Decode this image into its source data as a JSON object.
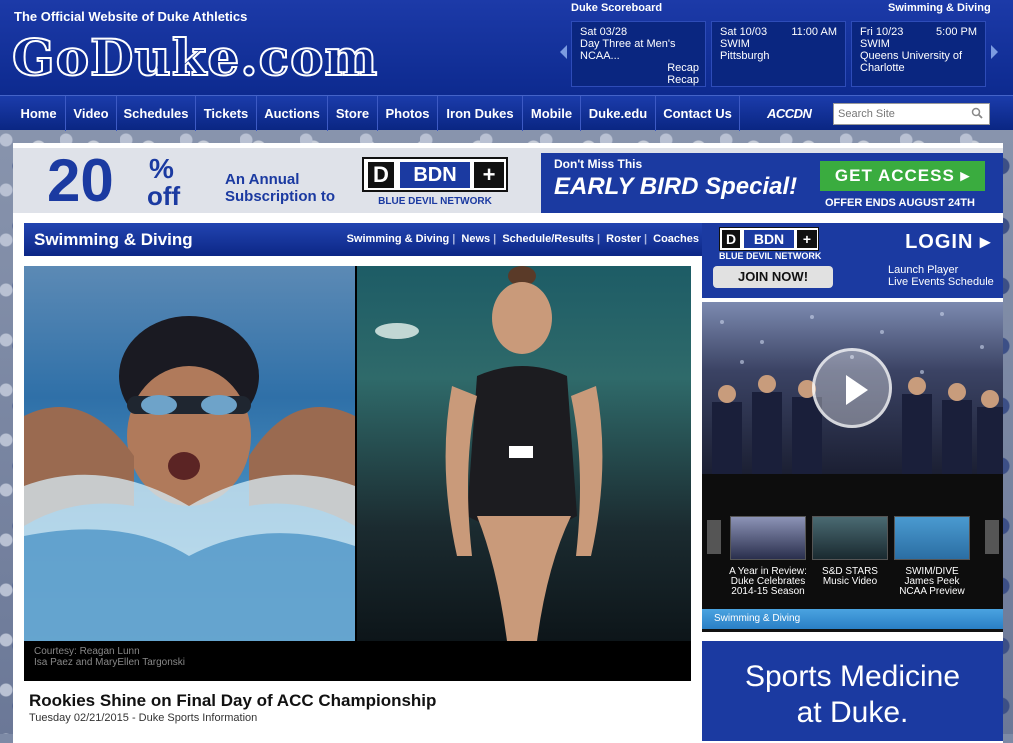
{
  "header": {
    "tagline": "The Official Website of Duke Athletics",
    "logo": "GoDuke.com"
  },
  "scoreboard": {
    "label": "Duke Scoreboard",
    "sport_label": "Swimming & Diving",
    "games": [
      {
        "date": "Sat 03/28",
        "line1": "Day Three at Men's",
        "line2": "NCAA...",
        "time": "",
        "rec1": "Recap",
        "rec2": "Recap"
      },
      {
        "date": "Sat  10/03",
        "line1": "SWIM",
        "line2": "Pittsburgh",
        "time": "11:00 AM",
        "rec1": "",
        "rec2": ""
      },
      {
        "date": "Fri  10/23",
        "line1": "SWIM",
        "line2": "Queens University of Charlotte",
        "time": "5:00 PM",
        "rec1": "",
        "rec2": ""
      }
    ]
  },
  "nav": {
    "items": [
      "Home",
      "Video",
      "Schedules",
      "Tickets",
      "Auctions",
      "Store",
      "Photos",
      "Iron Dukes",
      "Mobile",
      "Duke.edu",
      "Contact Us"
    ],
    "accn": "ACCDN",
    "search_placeholder": "Search Site"
  },
  "ad": {
    "percent": "20",
    "pct_sign": "%",
    "off": "off",
    "annual_l1": "An Annual",
    "annual_l2": "Subscription to",
    "bdn_d": "D",
    "bdn": "BDN",
    "bdn_plus": "+",
    "bdn_sub": "BLUE DEVIL NETWORK",
    "dont_miss": "Don't Miss This",
    "early_bird": "EARLY BIRD Special!",
    "cta": "GET ACCESS ▸",
    "offer_ends": "OFFER ENDS AUGUST 24TH"
  },
  "section": {
    "title": "Swimming & Diving",
    "links": [
      "Swimming & Diving",
      "News",
      "Schedule/Results",
      "Roster",
      "Coaches"
    ]
  },
  "hero": {
    "caption_l1": "Courtesy: Reagan Lunn",
    "caption_l2": "Isa Paez and MaryEllen Targonski"
  },
  "article": {
    "title": "Rookies Shine on Final Day of ACC Championship",
    "meta": "Tuesday 02/21/2015  -  Duke Sports Information"
  },
  "bdn_box": {
    "bdn_d": "D",
    "bdn": "BDN",
    "bdn_plus": "+",
    "sub": "BLUE DEVIL NETWORK",
    "login": "LOGIN ▸",
    "join": "JOIN NOW!",
    "launch": "Launch Player",
    "schedule": "Live Events Schedule"
  },
  "video": {
    "thumbs": [
      {
        "caption": "A Year in Review: Duke Celebrates 2014-15 Season"
      },
      {
        "caption": "S&D STARS Music Video"
      },
      {
        "caption": "SWIM/DIVE James Peek NCAA Preview"
      }
    ],
    "footer": "Swimming & Diving"
  },
  "sm_ad": {
    "line1": "Sports Medicine",
    "line2": "at Duke."
  }
}
